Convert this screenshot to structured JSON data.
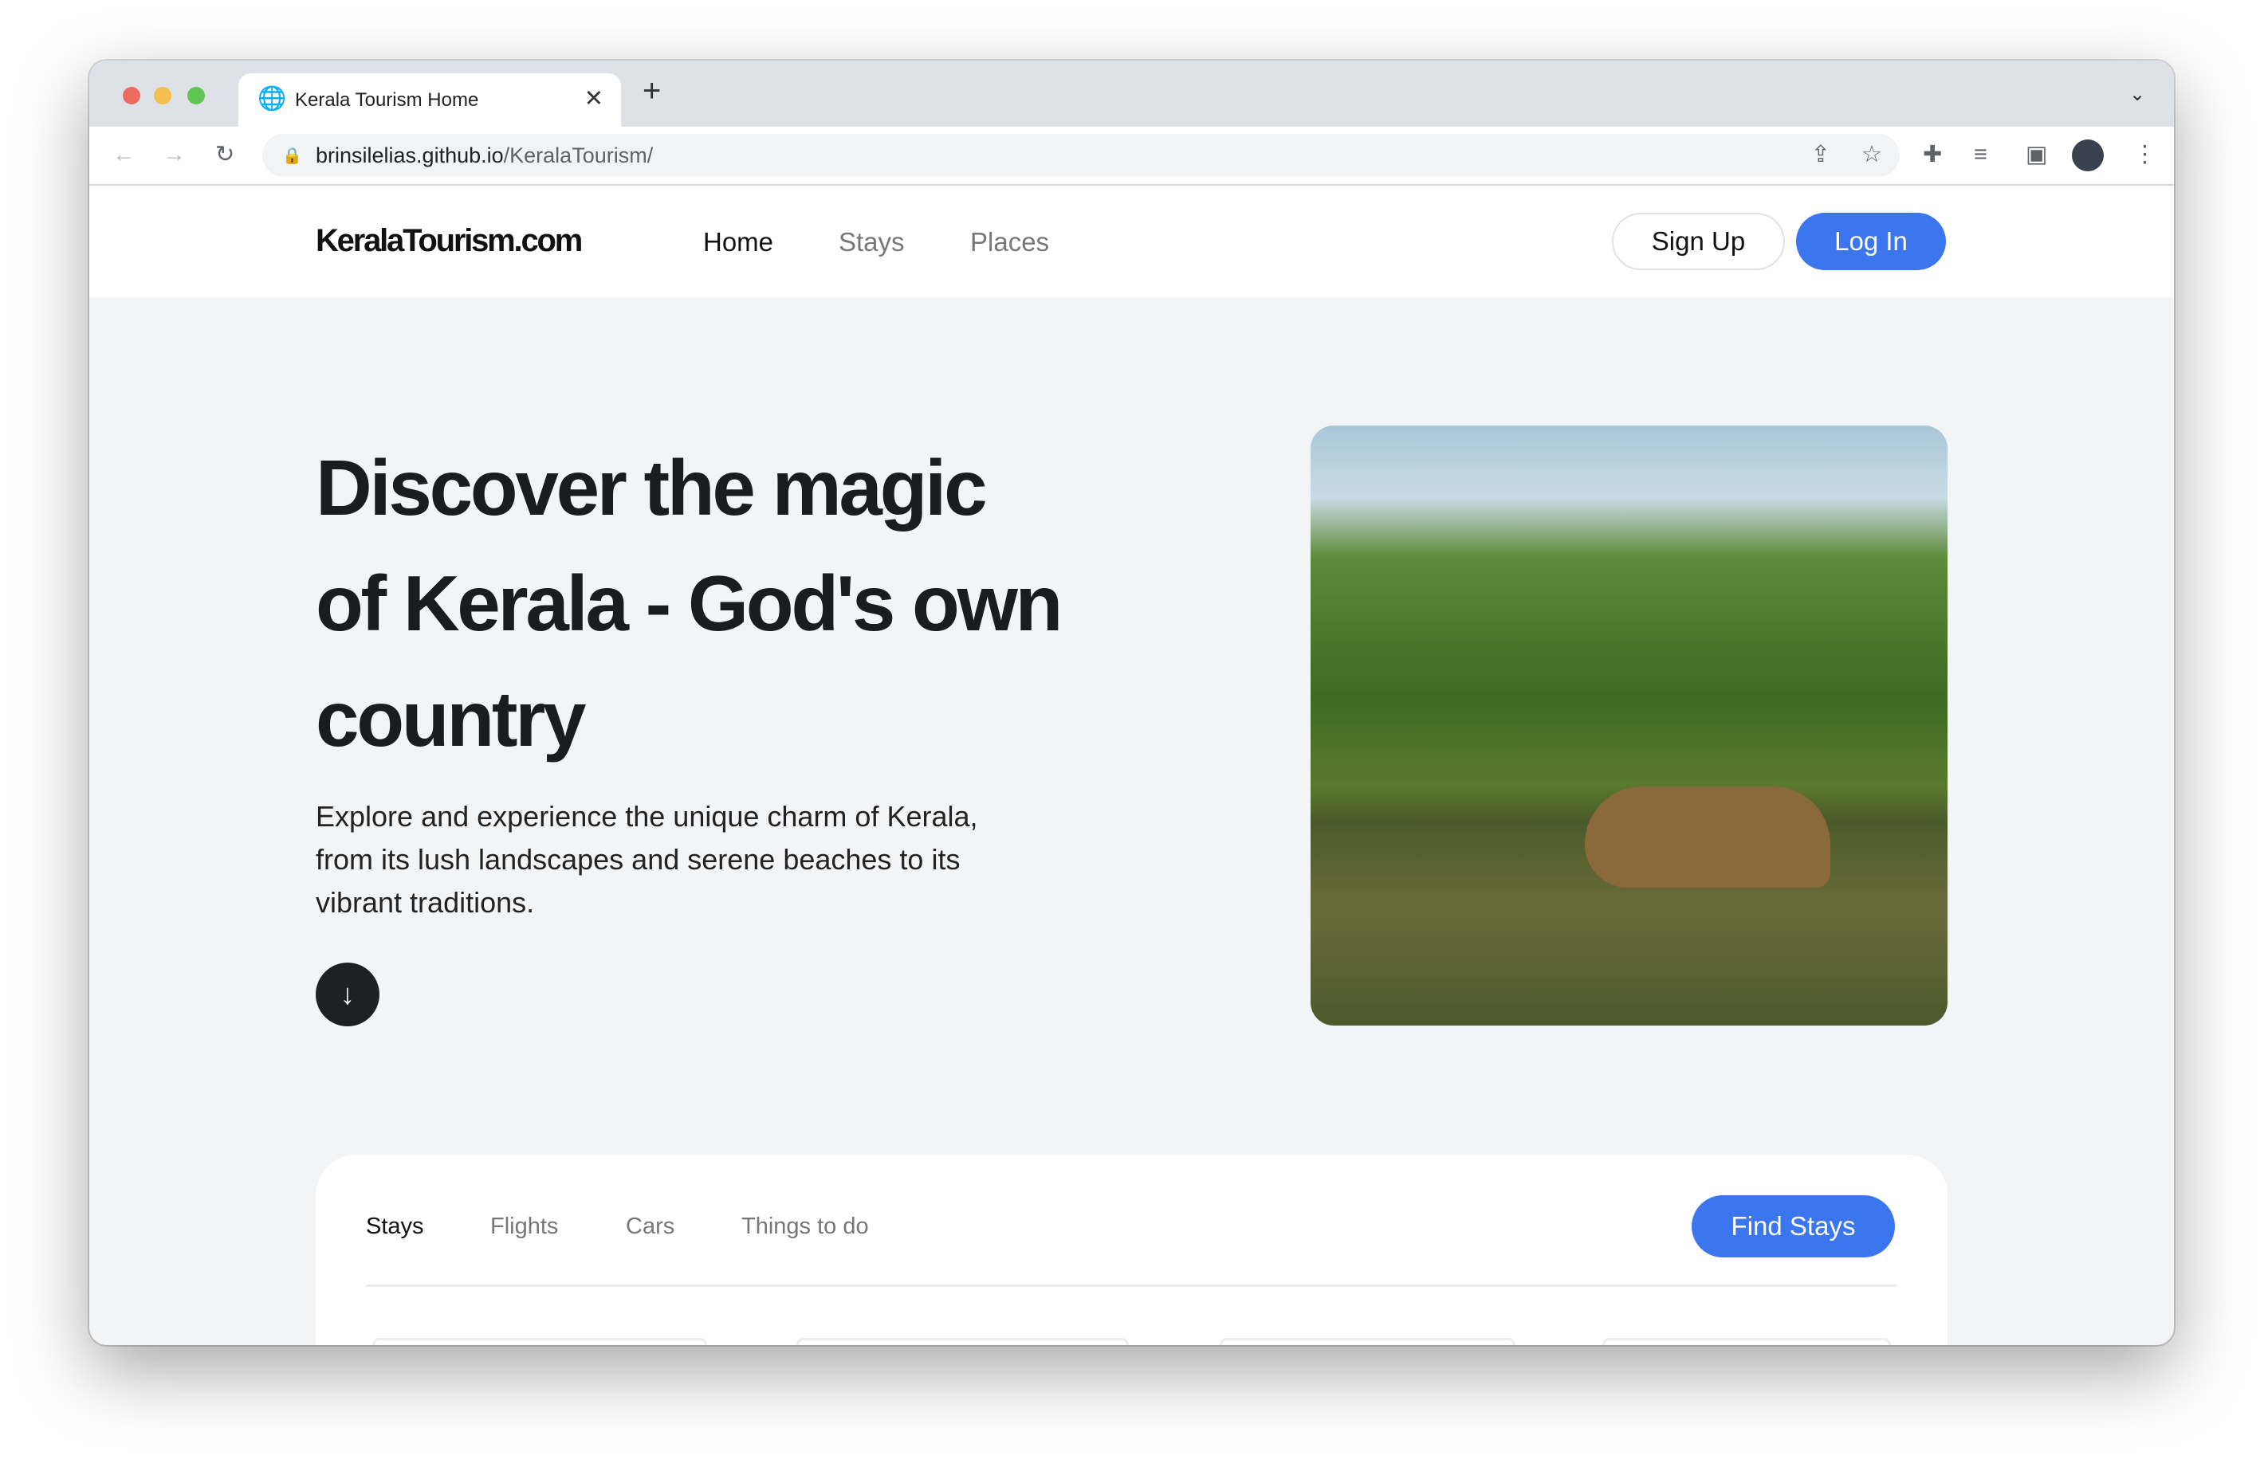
{
  "browser": {
    "tab_title": "Kerala Tourism Home",
    "url_host": "brinsilelias.github.io",
    "url_path": "/KeralaTourism/"
  },
  "header": {
    "logo": "KeralaTourism.com",
    "nav": [
      "Home",
      "Stays",
      "Places"
    ],
    "signup": "Sign Up",
    "login": "Log In"
  },
  "hero": {
    "title": "Discover the magic of Kerala - God's own country",
    "description": "Explore and experience the unique charm of Kerala, from its lush landscapes and serene beaches to its vibrant traditions."
  },
  "search": {
    "tabs": [
      "Stays",
      "Flights",
      "Cars",
      "Things to do"
    ],
    "active_tab": "Stays",
    "button": "Find Stays"
  },
  "colors": {
    "accent": "#3b76ef"
  }
}
